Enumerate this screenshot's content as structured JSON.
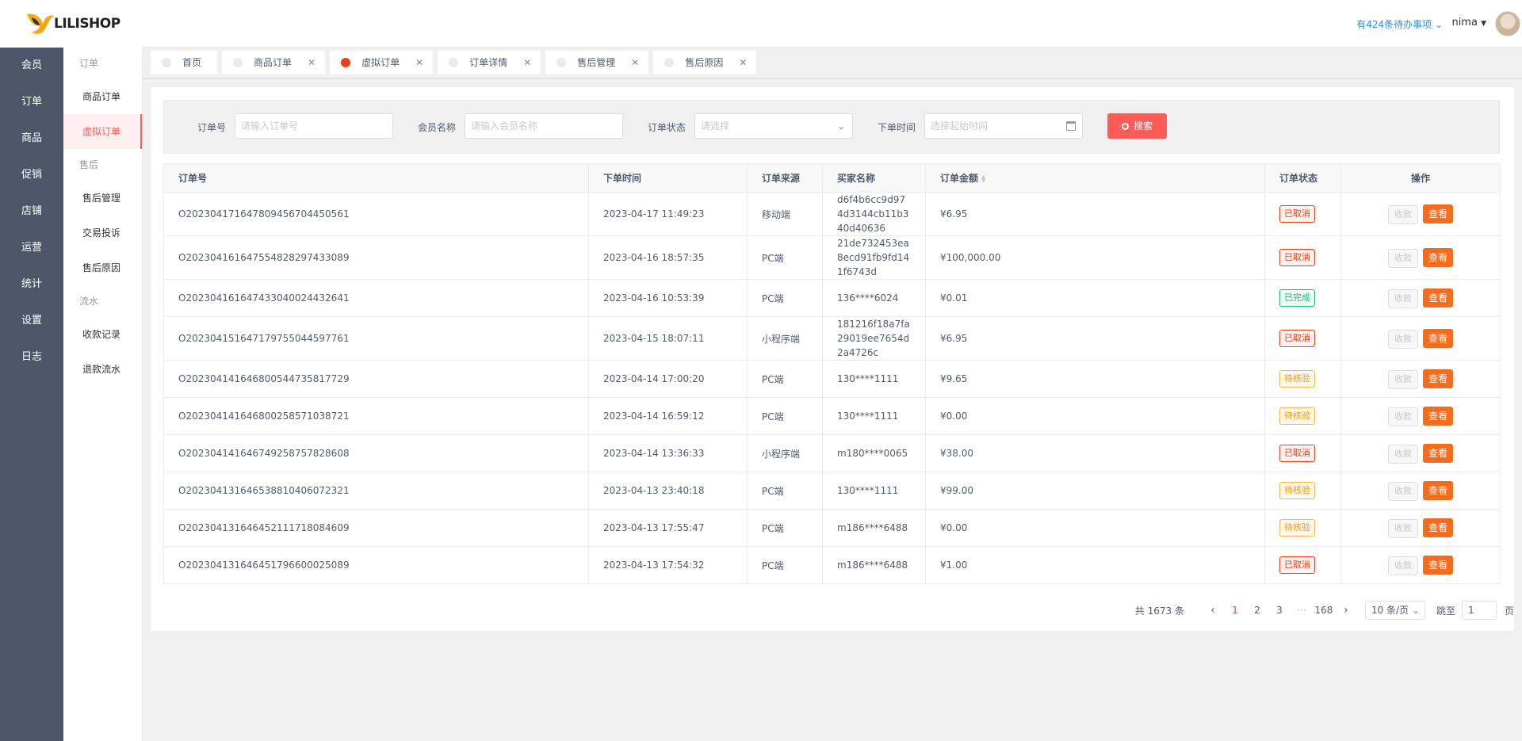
{
  "brand": {
    "logo_text": "LILISHOP",
    "accent": "#ff5c58"
  },
  "rail": {
    "items": [
      "会员",
      "订单",
      "商品",
      "促销",
      "店铺",
      "运营",
      "统计",
      "设置",
      "日志"
    ]
  },
  "submenu": {
    "groups": [
      {
        "title": "订单",
        "items": [
          "商品订单",
          "虚拟订单"
        ],
        "active": "虚拟订单"
      },
      {
        "title": "售后",
        "items": [
          "售后管理",
          "交易投诉",
          "售后原因"
        ]
      },
      {
        "title": "流水",
        "items": [
          "收款记录",
          "退款流水"
        ]
      }
    ]
  },
  "header": {
    "todo": "有424条待办事项",
    "user": "nima"
  },
  "tabs": [
    {
      "label": "首页",
      "closable": false,
      "active": false
    },
    {
      "label": "商品订单",
      "closable": true,
      "active": false
    },
    {
      "label": "虚拟订单",
      "closable": true,
      "active": true
    },
    {
      "label": "订单详情",
      "closable": true,
      "active": false
    },
    {
      "label": "售后管理",
      "closable": true,
      "active": false
    },
    {
      "label": "售后原因",
      "closable": true,
      "active": false
    }
  ],
  "filter": {
    "order_no_label": "订单号",
    "order_no_placeholder": "请输入订单号",
    "member_label": "会员名称",
    "member_placeholder": "请输入会员名称",
    "status_label": "订单状态",
    "status_placeholder": "请选择",
    "time_label": "下单时间",
    "time_placeholder": "选择起始时间",
    "search_label": "搜索"
  },
  "table": {
    "headers": [
      "订单号",
      "下单时间",
      "订单来源",
      "买家名称",
      "订单金额",
      "订单状态",
      "操作"
    ],
    "collect_label": "收款",
    "view_label": "查看",
    "rows": [
      {
        "no": "O202304171647809456704450561",
        "time": "2023-04-17 11:49:23",
        "source": "移动端",
        "buyer": "d6f4b6cc9d974d3144cb11b340d40636",
        "amount": "¥6.95",
        "status": "已取消",
        "tone": "red"
      },
      {
        "no": "O202304161647554828297433089",
        "time": "2023-04-16 18:57:35",
        "source": "PC端",
        "buyer": "21de732453ea8ecd91fb9fd141f6743d",
        "amount": "¥100,000.00",
        "status": "已取消",
        "tone": "red"
      },
      {
        "no": "O202304161647433040024432641",
        "time": "2023-04-16 10:53:39",
        "source": "PC端",
        "buyer": "136****6024",
        "amount": "¥0.01",
        "status": "已完成",
        "tone": "green"
      },
      {
        "no": "O202304151647179755044597761",
        "time": "2023-04-15 18:07:11",
        "source": "小程序端",
        "buyer": "181216f18a7fa29019ee7654d2a4726c",
        "amount": "¥6.95",
        "status": "已取消",
        "tone": "red"
      },
      {
        "no": "O202304141646800544735817729",
        "time": "2023-04-14 17:00:20",
        "source": "PC端",
        "buyer": "130****1111",
        "amount": "¥9.65",
        "status": "待核验",
        "tone": "orange"
      },
      {
        "no": "O202304141646800258571038721",
        "time": "2023-04-14 16:59:12",
        "source": "PC端",
        "buyer": "130****1111",
        "amount": "¥0.00",
        "status": "待核验",
        "tone": "orange"
      },
      {
        "no": "O202304141646749258757828608",
        "time": "2023-04-14 13:36:33",
        "source": "小程序端",
        "buyer": "m180****0065",
        "amount": "¥38.00",
        "status": "已取消",
        "tone": "red"
      },
      {
        "no": "O202304131646538810406072321",
        "time": "2023-04-13 23:40:18",
        "source": "PC端",
        "buyer": "130****1111",
        "amount": "¥99.00",
        "status": "待核验",
        "tone": "orange"
      },
      {
        "no": "O202304131646452111718084609",
        "time": "2023-04-13 17:55:47",
        "source": "PC端",
        "buyer": "m186****6488",
        "amount": "¥0.00",
        "status": "待核验",
        "tone": "orange"
      },
      {
        "no": "O202304131646451796600025089",
        "time": "2023-04-13 17:54:32",
        "source": "PC端",
        "buyer": "m186****6488",
        "amount": "¥1.00",
        "status": "已取消",
        "tone": "red"
      }
    ]
  },
  "pager": {
    "total": "共 1673 条",
    "pages": [
      "1",
      "2",
      "3",
      "···",
      "168"
    ],
    "current": "1",
    "size": "10 条/页",
    "jump_label": "跳至",
    "jump_value": "1",
    "page_unit": "页"
  }
}
